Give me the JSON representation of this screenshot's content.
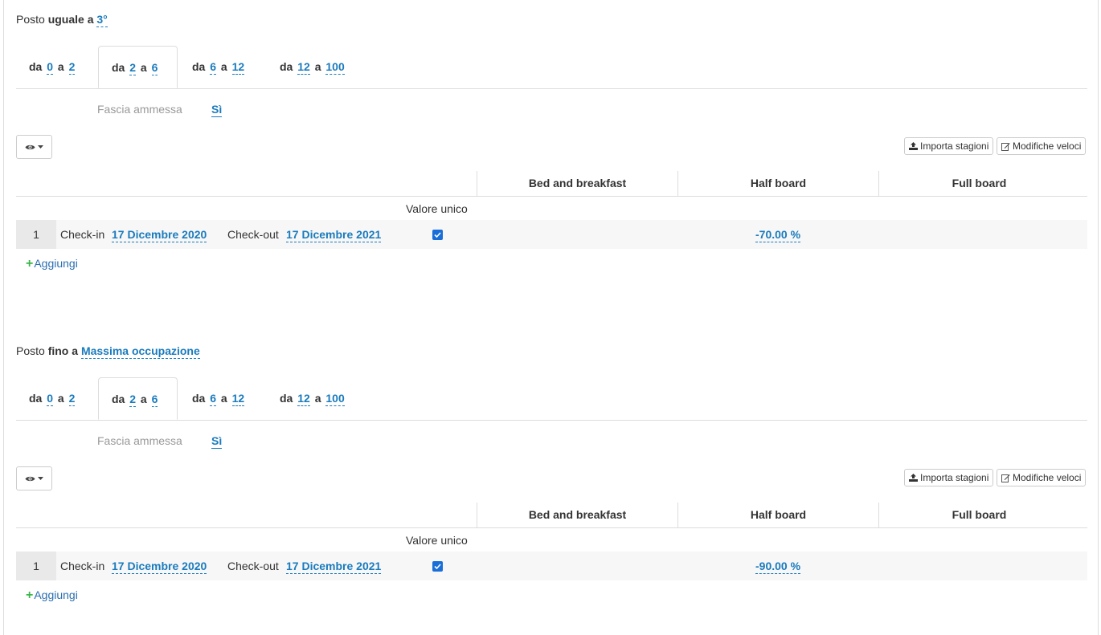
{
  "sections": [
    {
      "posto_prefix": "Posto",
      "posto_rule": "uguale a",
      "posto_value": "3°",
      "tabs": [
        {
          "da": "da",
          "a": "a",
          "from": "0",
          "to": "2",
          "active": false
        },
        {
          "da": "da",
          "a": "a",
          "from": "2",
          "to": "6",
          "active": true
        },
        {
          "da": "da",
          "a": "a",
          "from": "6",
          "to": "12",
          "active": false
        },
        {
          "da": "da",
          "a": "a",
          "from": "12",
          "to": "100",
          "active": false
        }
      ],
      "fascia_label": "Fascia ammessa",
      "fascia_value": "Sì",
      "import_label": "Importa stagioni",
      "edit_label": "Modifiche veloci",
      "columns": [
        "Bed and breakfast",
        "Half board",
        "Full board"
      ],
      "valore_label": "Valore unico",
      "rows": [
        {
          "num": "1",
          "checkin_label": "Check-in",
          "checkin_date": "17 Dicembre 2020",
          "checkout_label": "Check-out",
          "checkout_date": "17 Dicembre 2021",
          "checked": true,
          "half_board": "-70.00 %"
        }
      ],
      "add_label": "Aggiungi"
    },
    {
      "posto_prefix": "Posto",
      "posto_rule": "fino a",
      "posto_value": "Massima occupazione",
      "tabs": [
        {
          "da": "da",
          "a": "a",
          "from": "0",
          "to": "2",
          "active": false
        },
        {
          "da": "da",
          "a": "a",
          "from": "2",
          "to": "6",
          "active": true
        },
        {
          "da": "da",
          "a": "a",
          "from": "6",
          "to": "12",
          "active": false
        },
        {
          "da": "da",
          "a": "a",
          "from": "12",
          "to": "100",
          "active": false
        }
      ],
      "fascia_label": "Fascia ammessa",
      "fascia_value": "Sì",
      "import_label": "Importa stagioni",
      "edit_label": "Modifiche veloci",
      "columns": [
        "Bed and breakfast",
        "Half board",
        "Full board"
      ],
      "valore_label": "Valore unico",
      "rows": [
        {
          "num": "1",
          "checkin_label": "Check-in",
          "checkin_date": "17 Dicembre 2020",
          "checkout_label": "Check-out",
          "checkout_date": "17 Dicembre 2021",
          "checked": true,
          "half_board": "-90.00 %"
        }
      ],
      "add_label": "Aggiungi"
    }
  ],
  "colors": {
    "link": "#1a7bbd",
    "check": "#1a6ed8",
    "plus": "#3bb54a"
  },
  "icons": [
    "eye-icon",
    "caret-down-icon",
    "upload-icon",
    "edit-icon",
    "check-icon",
    "plus-icon"
  ]
}
